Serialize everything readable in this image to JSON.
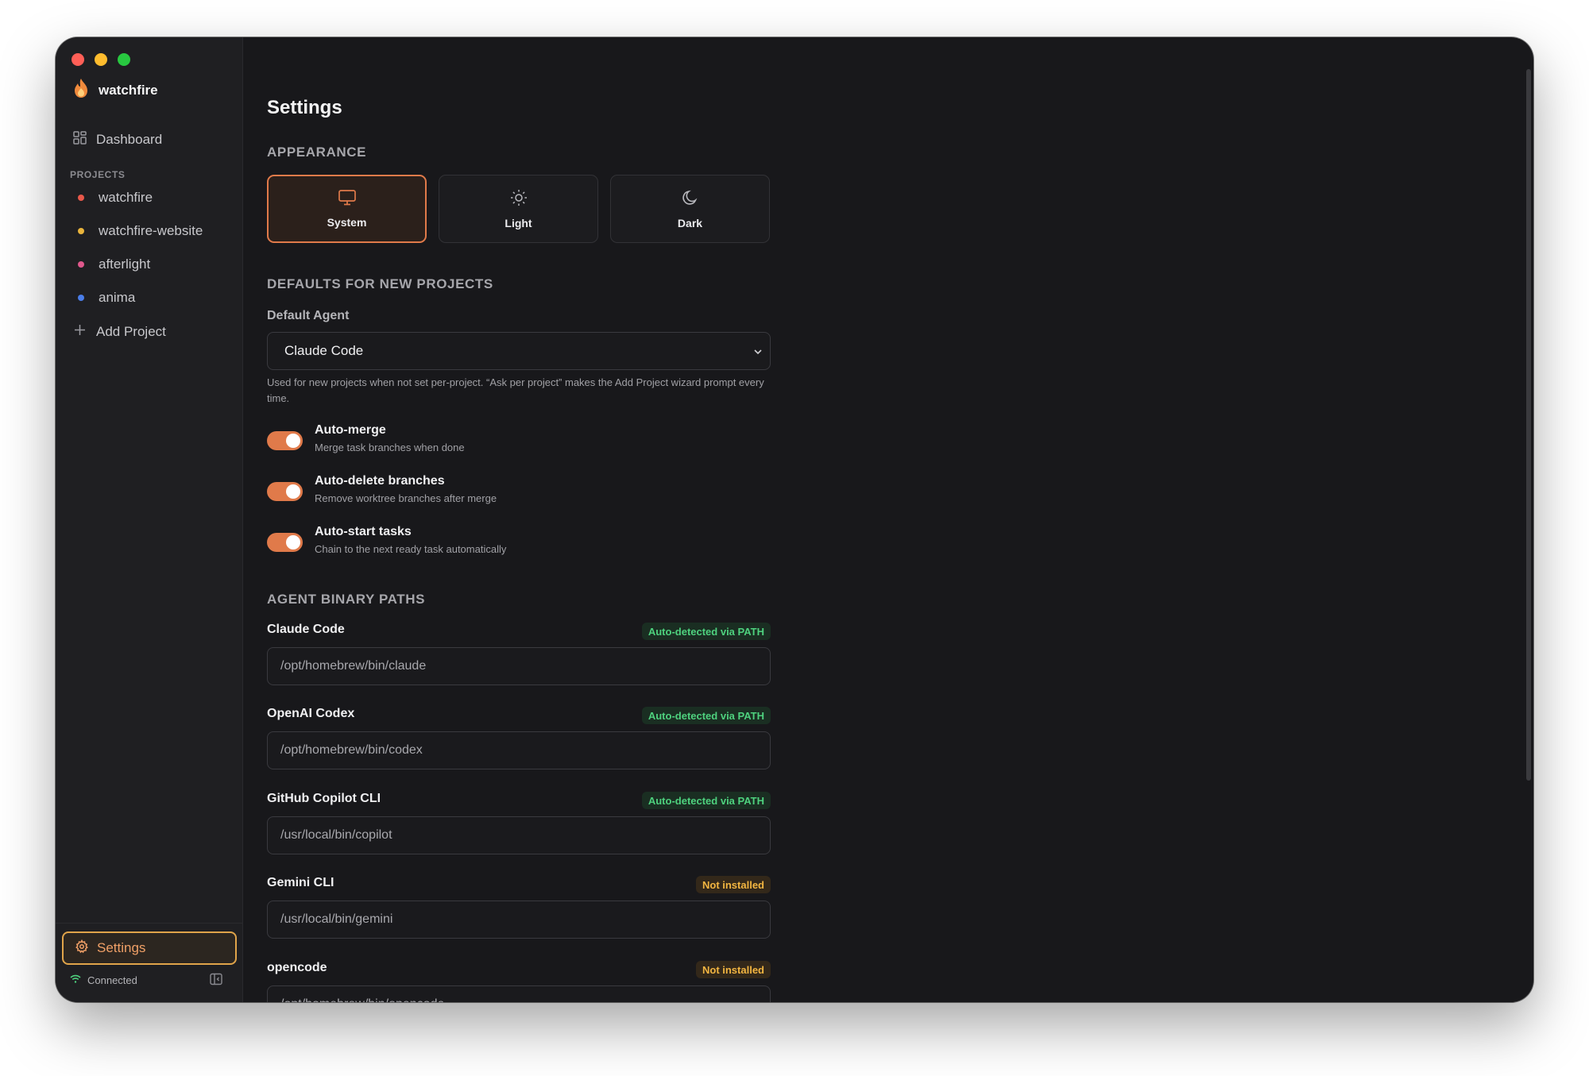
{
  "sidebar": {
    "brand": "watchfire",
    "dashboard": "Dashboard",
    "projects_label": "PROJECTS",
    "projects": [
      {
        "name": "watchfire",
        "color": "#e8584a"
      },
      {
        "name": "watchfire-website",
        "color": "#e9b43c"
      },
      {
        "name": "afterlight",
        "color": "#e0588c"
      },
      {
        "name": "anima",
        "color": "#4a7de8"
      }
    ],
    "add_project": "Add Project",
    "settings": "Settings",
    "status": "Connected"
  },
  "main": {
    "title": "Settings",
    "appearance": {
      "heading": "APPEARANCE",
      "options": [
        {
          "label": "System",
          "icon": "monitor-icon",
          "active": true
        },
        {
          "label": "Light",
          "icon": "sun-icon",
          "active": false
        },
        {
          "label": "Dark",
          "icon": "moon-icon",
          "active": false
        }
      ]
    },
    "defaults": {
      "heading": "DEFAULTS FOR NEW PROJECTS",
      "agent_label": "Default Agent",
      "agent_value": "Claude Code",
      "help": "Used for new projects when not set per-project. “Ask per project” makes the Add Project wizard prompt every time.",
      "toggles": [
        {
          "title": "Auto-merge",
          "subtitle": "Merge task branches when done",
          "on": true
        },
        {
          "title": "Auto-delete branches",
          "subtitle": "Remove worktree branches after merge",
          "on": true
        },
        {
          "title": "Auto-start tasks",
          "subtitle": "Chain to the next ready task automatically",
          "on": true
        }
      ]
    },
    "binary_paths": {
      "heading": "AGENT BINARY PATHS",
      "agents": [
        {
          "name": "Claude Code",
          "status": "Auto-detected via PATH",
          "path": "/opt/homebrew/bin/claude"
        },
        {
          "name": "OpenAI Codex",
          "status": "Auto-detected via PATH",
          "path": "/opt/homebrew/bin/codex"
        },
        {
          "name": "GitHub Copilot CLI",
          "status": "Auto-detected via PATH",
          "path": "/usr/local/bin/copilot"
        },
        {
          "name": "Gemini CLI",
          "status": "Not installed",
          "path": "/usr/local/bin/gemini"
        },
        {
          "name": "opencode",
          "status": "Not installed",
          "path": "/opt/homebrew/bin/opencode"
        }
      ]
    }
  },
  "colors": {
    "accent": "#e07a4a",
    "ok": "#4ed17e",
    "warn": "#f2b541"
  }
}
